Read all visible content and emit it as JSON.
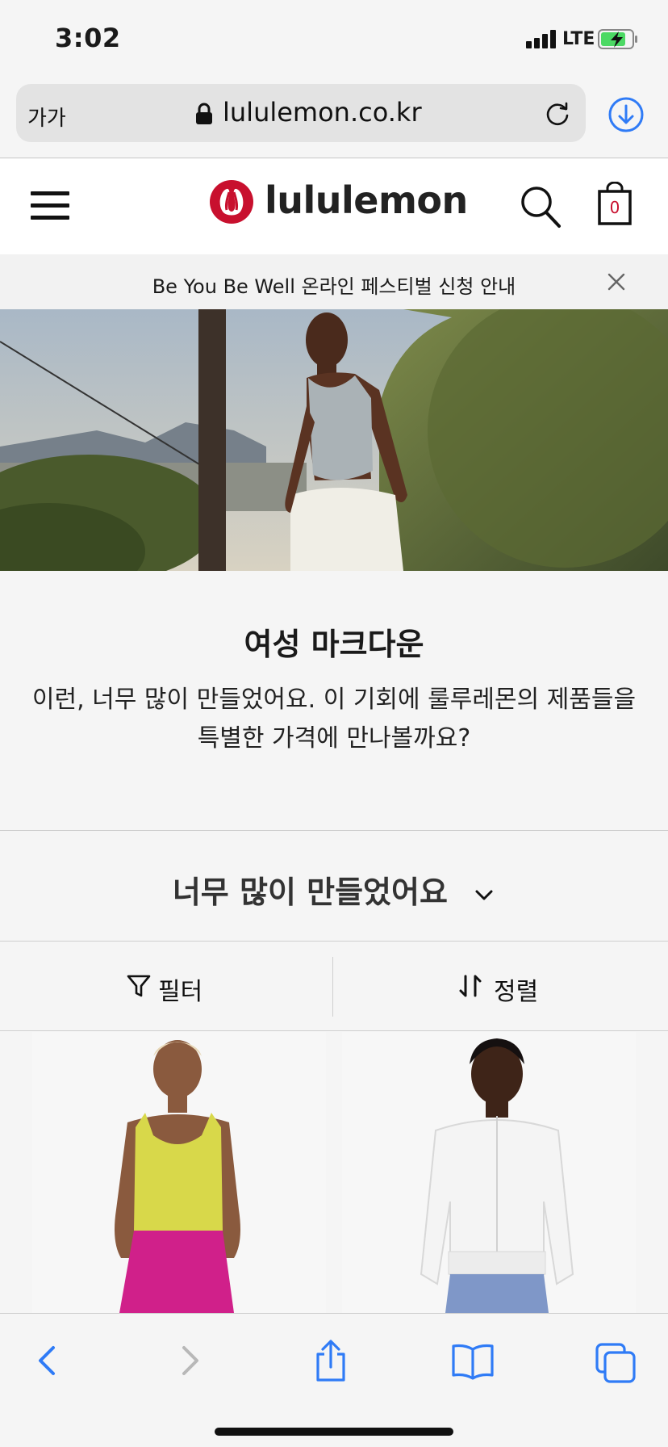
{
  "status": {
    "time": "3:02",
    "network": "LTE"
  },
  "browser": {
    "text_size_label": "가가",
    "url": "lululemon.co.kr"
  },
  "site": {
    "brand": "lululemon",
    "cart_count": "0",
    "announcement": "Be You Be Well 온라인 페스티벌 신청 안내"
  },
  "page": {
    "title": "여성 마크다운",
    "description": "이런, 너무 많이 만들었어요. 이 기회에 룰루레몬의 제품들을 특별한 가격에 만나볼까요?",
    "category_label": "너무 많이 만들었어요"
  },
  "toolbar": {
    "filter_label": "필터",
    "sort_label": "정렬"
  },
  "colors": {
    "brand_red": "#c8102e",
    "ios_blue": "#2f7bf6",
    "battery_green": "#4cd964"
  },
  "icons": {
    "back": "chevron-left-icon",
    "forward": "chevron-right-icon",
    "share": "share-icon",
    "bookmarks": "book-icon",
    "tabs": "tabs-icon"
  }
}
